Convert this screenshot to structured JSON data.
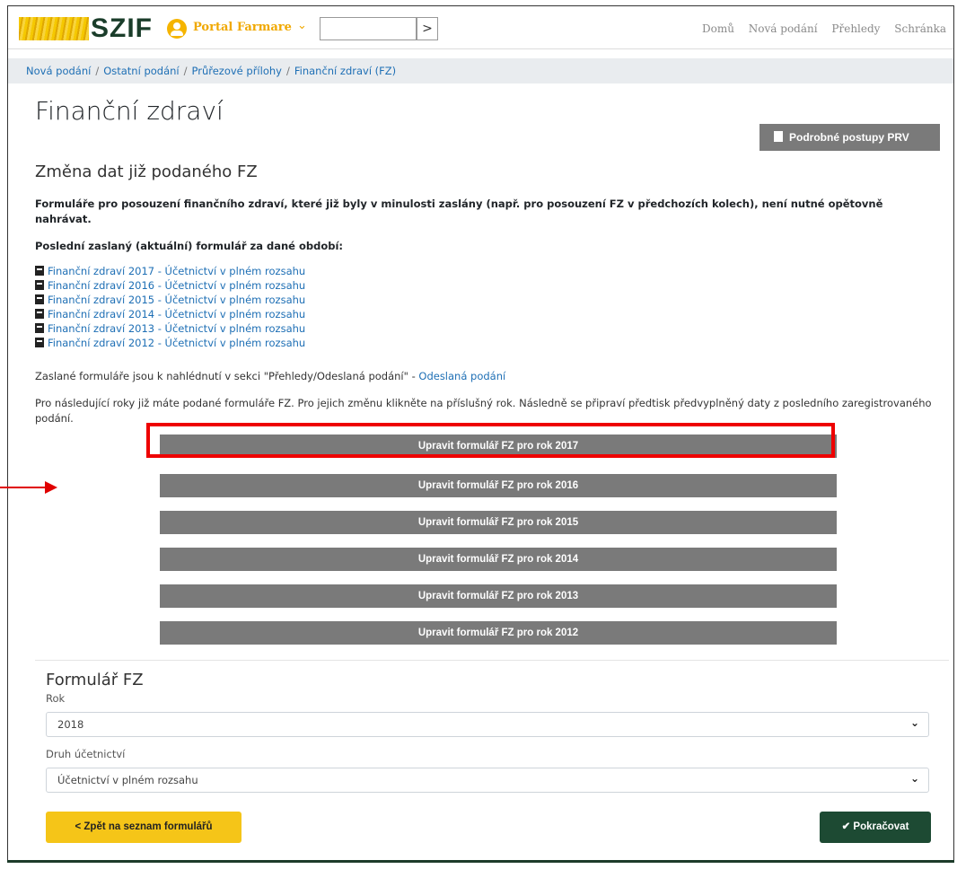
{
  "header": {
    "logo_text": "SZIF",
    "portal_label": "Portal Farmare",
    "portal_chevron": "⌄",
    "search_button": ">",
    "nav": [
      "Domů",
      "Nová podání",
      "Přehledy",
      "Schránka"
    ]
  },
  "breadcrumb": [
    "Nová podání",
    "Ostatní podání",
    "Průřezové přílohy",
    "Finanční zdraví (FZ)"
  ],
  "page": {
    "title": "Finanční zdraví",
    "postupy_button": "Podrobné postupy PRV",
    "section_title": "Změna dat již podaného FZ",
    "intro_bold": "Formuláře pro posouzení finančního zdraví, které již byly v minulosti zaslány (např. pro posouzení FZ v předchozích kolech), není nutné opětovně nahrávat.",
    "last_sent_label": "Poslední zaslaný (aktuální) formulář za dané období:",
    "links": [
      "Finanční zdraví 2017 - Účetnictví v plném rozsahu",
      "Finanční zdraví 2016 - Účetnictví v plném rozsahu",
      "Finanční zdraví 2015 - Účetnictví v plném rozsahu",
      "Finanční zdraví 2014 - Účetnictví v plném rozsahu",
      "Finanční zdraví 2013 - Účetnictví v plném rozsahu",
      "Finanční zdraví 2012 - Účetnictví v plném rozsahu"
    ],
    "sent_text": "Zaslané formuláře jsou k nahlédnutí v sekci \"Přehledy/Odeslaná podání\" - ",
    "sent_link": "Odeslaná podání",
    "info_text": "Pro následující roky již máte podané formuláře FZ. Pro jejich změnu klikněte na příslušný rok. Následně se připraví předtisk předvyplněný daty z posledního zaregistrovaného podání.",
    "edit_buttons": [
      "Upravit formulář FZ pro rok 2017",
      "Upravit formulář FZ pro rok 2016",
      "Upravit formulář FZ pro rok 2015",
      "Upravit formulář FZ pro rok 2014",
      "Upravit formulář FZ pro rok 2013",
      "Upravit formulář FZ pro rok 2012"
    ]
  },
  "form": {
    "title": "Formulář FZ",
    "rok_label": "Rok",
    "rok_value": "2018",
    "druh_label": "Druh účetnictví",
    "druh_value": "Účetnictví v plném rozsahu",
    "chevron": "⌄",
    "back_button": "Zpět na seznam formulářů",
    "back_chevron": "<",
    "next_button": "Pokračovat",
    "next_check": "✔"
  },
  "colors": {
    "brand_yellow": "#f5c518",
    "brand_green": "#1d4a33",
    "button_gray": "#7a7a7a",
    "link_blue": "#1e6fb5",
    "highlight_red": "#ee0000"
  }
}
